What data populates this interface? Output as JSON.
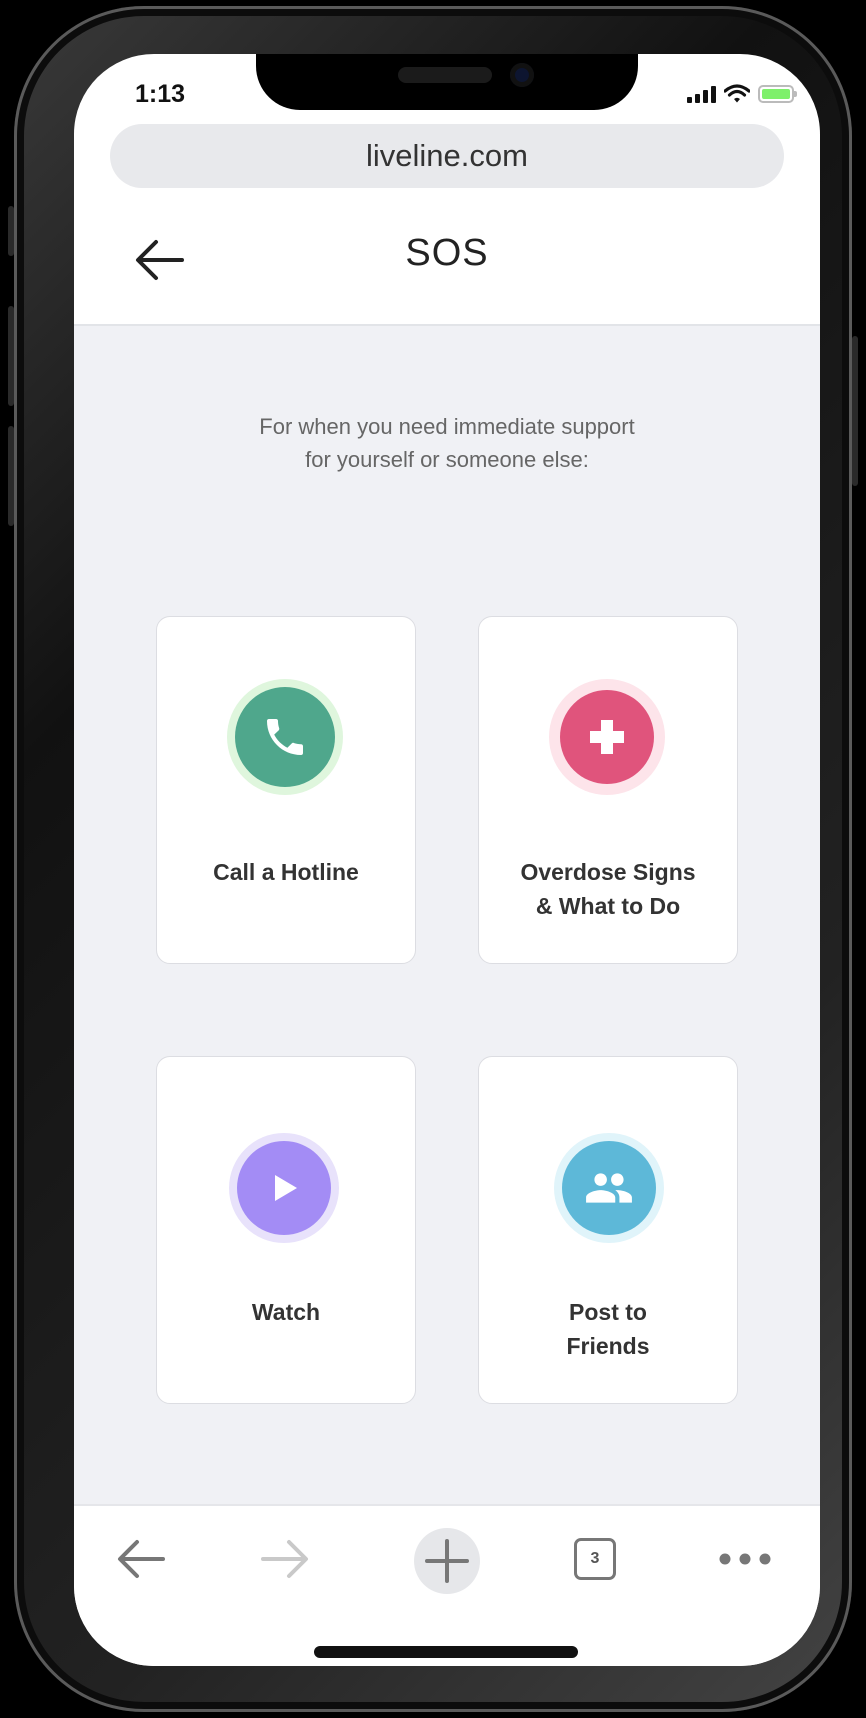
{
  "status_bar": {
    "time": "1:13"
  },
  "browser": {
    "url": "liveline.com",
    "tab_count": "3"
  },
  "header": {
    "title": "SOS"
  },
  "intro": {
    "text": "For when you need immediate support\nfor yourself or someone else:"
  },
  "cards": [
    {
      "label": "Call a Hotline",
      "icon": "phone-icon",
      "color": "#4fa78c",
      "ring": "#dff6dd"
    },
    {
      "label": "Overdose Signs\n& What to Do",
      "icon": "plus-icon",
      "color": "#e0547c",
      "ring": "#fde4ea"
    },
    {
      "label": "Watch",
      "icon": "play-icon",
      "color": "#a38cf5",
      "ring": "#e8e2fb"
    },
    {
      "label": "Post to\nFriends",
      "icon": "group-icon",
      "color": "#5db8d8",
      "ring": "#e0f4fa"
    }
  ],
  "colors": {
    "background": "#f0f1f5",
    "battery": "#7ef06b"
  }
}
